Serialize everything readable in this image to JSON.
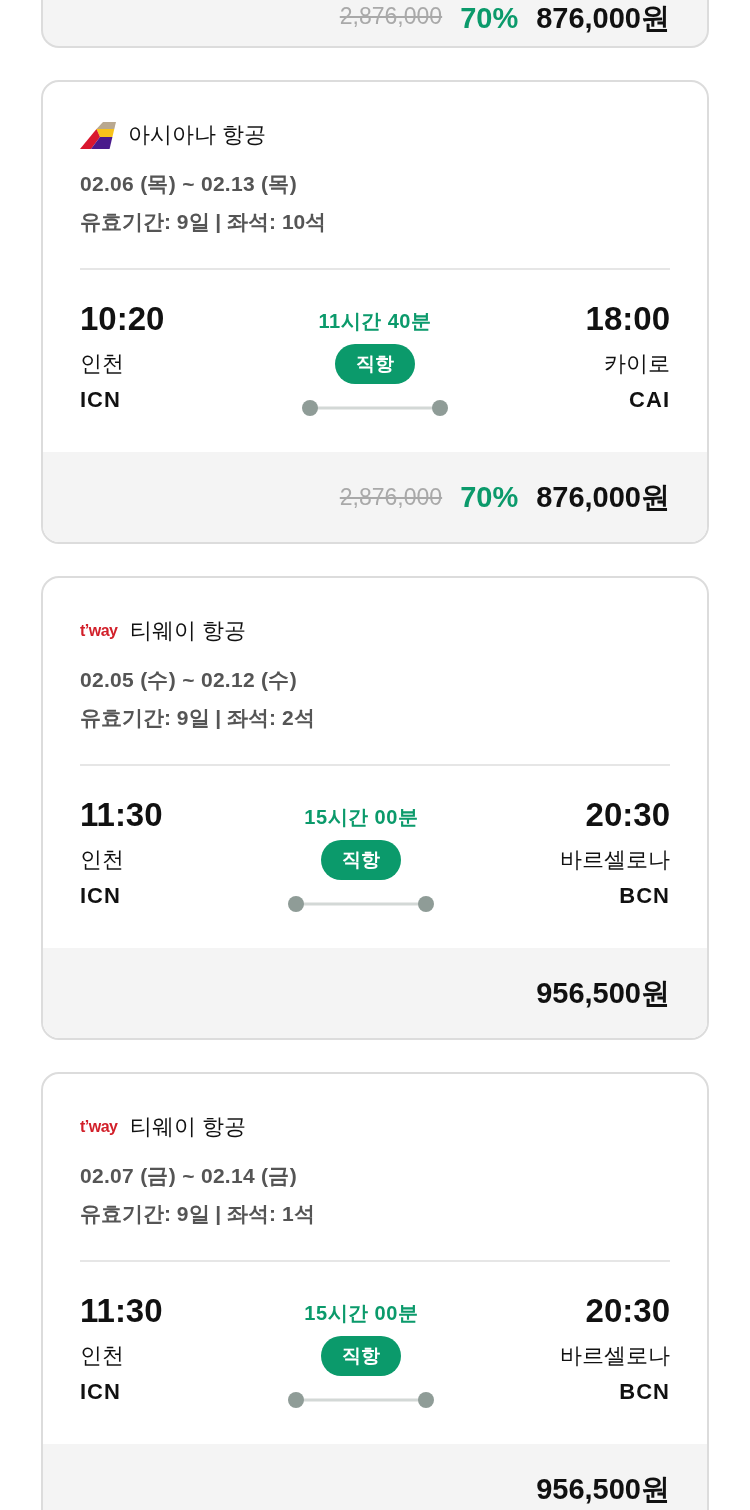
{
  "top_partial_card": {
    "price": {
      "original": "2,876,000",
      "discount": "70%",
      "final": "876,000원"
    }
  },
  "cards": [
    {
      "airline": {
        "name": "아시아나 항공",
        "logo": {
          "kind": "tail"
        }
      },
      "dates": "02.06 (목) ~ 02.13 (목)",
      "details": "유효기간: 9일 **|** 좌석: 10석",
      "departure": {
        "time": "10:20",
        "city": "인천",
        "code": "ICN"
      },
      "duration": "11시간 40분",
      "badge": "직항",
      "arrival": {
        "time": "18:00",
        "city": "카이로",
        "code": "CAI"
      },
      "price": {
        "original": "2,876,000",
        "discount": "70%",
        "final": "876,000원"
      }
    },
    {
      "airline": {
        "name": "티웨이 항공",
        "logo": {
          "kind": "wordmark",
          "text": "t’way"
        }
      },
      "dates": "02.05 (수) ~ 02.12 (수)",
      "details": "유효기간: 9일 **|** 좌석: 2석",
      "departure": {
        "time": "11:30",
        "city": "인천",
        "code": "ICN"
      },
      "duration": "15시간 00분",
      "badge": "직항",
      "arrival": {
        "time": "20:30",
        "city": "바르셀로나",
        "code": "BCN"
      },
      "price": {
        "final": "956,500원"
      }
    },
    {
      "airline": {
        "name": "티웨이 항공",
        "logo": {
          "kind": "wordmark",
          "text": "t’way"
        }
      },
      "dates": "02.07 (금) ~ 02.14 (금)",
      "details": "유효기간: 9일 **|** 좌석: 1석",
      "departure": {
        "time": "11:30",
        "city": "인천",
        "code": "ICN"
      },
      "duration": "15시간 00분",
      "badge": "직항",
      "arrival": {
        "time": "20:30",
        "city": "바르셀로나",
        "code": "BCN"
      },
      "price": {
        "final": "956,500원"
      }
    }
  ]
}
